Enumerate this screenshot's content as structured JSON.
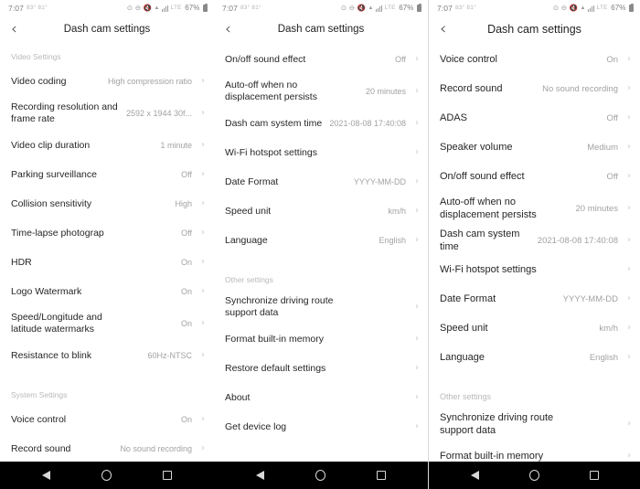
{
  "status_bar": {
    "time": "7:07",
    "mini_text": "83° 81°",
    "battery_percent": "67%",
    "icons": [
      "alarm-icon",
      "do-not-disturb-icon",
      "mute-icon",
      "wifi-icon",
      "signal-icon",
      "lte-icon",
      "battery-icon"
    ],
    "lte_label": "LTE"
  },
  "app_bar": {
    "back_icon": "back-chevron-icon",
    "title": "Dash cam settings"
  },
  "nav_bar": {
    "back_icon": "nav-back-icon",
    "home_icon": "nav-home-icon",
    "recents_icon": "nav-recents-icon"
  },
  "colors": {
    "background": "#ffffff",
    "label_text": "#262626",
    "value_text": "#a2a2a2",
    "section_header": "#b9b9b9",
    "chevron": "#c9c9c9",
    "nav_bar": "#000000"
  },
  "panels": [
    {
      "id": "panel-1",
      "sections": [
        {
          "header": "Video Settings",
          "rows": [
            {
              "label": "Video coding",
              "value": "High compression ratio"
            },
            {
              "label": "Recording resolution and\nframe rate",
              "value": "2592 x 1944 30f..."
            },
            {
              "label": "Video clip duration",
              "value": "1 minute"
            },
            {
              "label": "Parking surveillance",
              "value": "Off"
            },
            {
              "label": "Collision sensitivity",
              "value": "High"
            },
            {
              "label": "Time-lapse photograp",
              "value": "Off"
            },
            {
              "label": "HDR",
              "value": "On"
            },
            {
              "label": "Logo Watermark",
              "value": "On"
            },
            {
              "label": "Speed/Longitude and\nlatitude watermarks",
              "value": "On"
            },
            {
              "label": "Resistance to blink",
              "value": "60Hz-NTSC"
            }
          ]
        },
        {
          "header": "System Settings",
          "rows": [
            {
              "label": "Voice control",
              "value": "On"
            },
            {
              "label": "Record sound",
              "value": "No sound recording"
            }
          ]
        }
      ]
    },
    {
      "id": "panel-2",
      "sections": [
        {
          "header": "",
          "rows": [
            {
              "label": "On/off sound effect",
              "value": "Off"
            },
            {
              "label": "Auto-off when no\ndisplacement persists",
              "value": "20 minutes"
            },
            {
              "label": "Dash cam system time",
              "value": "2021-08-08 17:40:08"
            },
            {
              "label": "Wi-Fi hotspot settings",
              "value": ""
            },
            {
              "label": "Date Format",
              "value": "YYYY-MM-DD"
            },
            {
              "label": "Speed unit",
              "value": "km/h"
            },
            {
              "label": "Language",
              "value": "English"
            }
          ]
        },
        {
          "header": "Other settings",
          "rows": [
            {
              "label": "Synchronize driving route\nsupport data",
              "value": ""
            },
            {
              "label": "Format built-in memory",
              "value": ""
            },
            {
              "label": "Restore default settings",
              "value": ""
            },
            {
              "label": "About",
              "value": ""
            },
            {
              "label": "Get device log",
              "value": ""
            }
          ]
        }
      ]
    },
    {
      "id": "panel-3",
      "sections": [
        {
          "header": "",
          "rows": [
            {
              "label": "Voice control",
              "value": "On"
            },
            {
              "label": "Record sound",
              "value": "No sound recording"
            },
            {
              "label": "ADAS",
              "value": "Off"
            },
            {
              "label": "Speaker volume",
              "value": "Medium"
            },
            {
              "label": "On/off sound effect",
              "value": "Off"
            },
            {
              "label": "Auto-off when no\ndisplacement persists",
              "value": "20 minutes"
            },
            {
              "label": "Dash cam system time",
              "value": "2021-08-08 17:40:08"
            },
            {
              "label": "Wi-Fi hotspot settings",
              "value": ""
            },
            {
              "label": "Date Format",
              "value": "YYYY-MM-DD"
            },
            {
              "label": "Speed unit",
              "value": "km/h"
            },
            {
              "label": "Language",
              "value": "English"
            }
          ]
        },
        {
          "header": "Other settings",
          "rows": [
            {
              "label": "Synchronize driving route\nsupport data",
              "value": ""
            },
            {
              "label": "Format built-in memory",
              "value": ""
            }
          ]
        }
      ]
    }
  ]
}
